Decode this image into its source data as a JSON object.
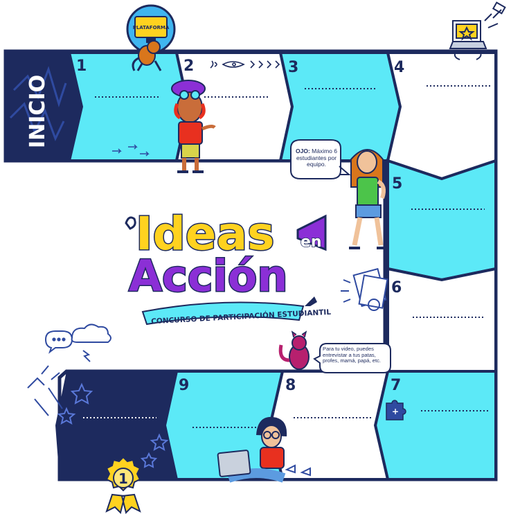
{
  "board": {
    "start_label": "INICIO",
    "squares": [
      {
        "number": "1"
      },
      {
        "number": "2"
      },
      {
        "number": "3"
      },
      {
        "number": "4"
      },
      {
        "number": "5"
      },
      {
        "number": "6"
      },
      {
        "number": "7"
      },
      {
        "number": "8"
      },
      {
        "number": "9"
      }
    ]
  },
  "badges": {
    "monitor_label": "PLATAFORMA",
    "medal_number": "1"
  },
  "logo": {
    "line1": "Ideas",
    "line1_small": "en",
    "line2": "Acción",
    "subtitle": "CONCURSO DE PARTICIPACIÓN ESTUDIANTIL"
  },
  "bubbles": {
    "team_note_bold": "OJO:",
    "team_note": "Máximo 6 estudiantes por equipo.",
    "video_note": "Para tu video, puedes entrevistar a tus patas, profes, mamá, papá, etc."
  },
  "colors": {
    "navy": "#1d2a5e",
    "cyan": "#5ce9f7",
    "yellow": "#ffd21f",
    "purple": "#8b2fd6",
    "white": "#ffffff"
  }
}
